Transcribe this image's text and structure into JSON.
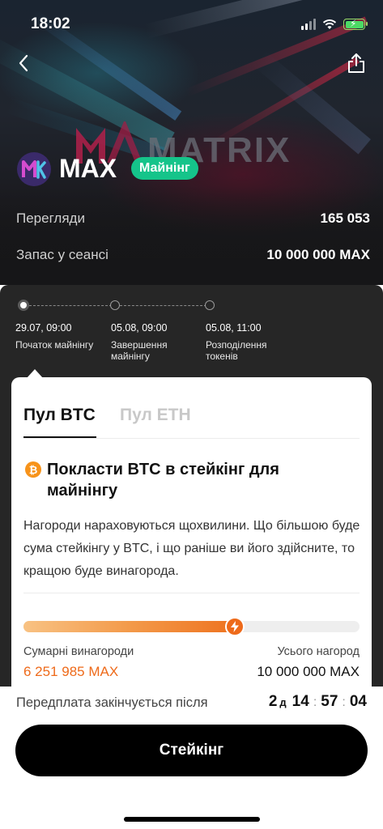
{
  "status_bar": {
    "time": "18:02"
  },
  "header": {
    "back_icon": "chevron-left-icon",
    "share_icon": "share-icon"
  },
  "hero": {
    "background_text": "MATRIX",
    "token_name": "MAX",
    "badge": "Майнінг",
    "views_label": "Перегляди",
    "views_value": "165 053",
    "supply_label": "Запас у сеансі",
    "supply_value": "10 000 000 MAX"
  },
  "timeline": [
    {
      "date": "29.07, 09:00",
      "label": "Початок майнінгу",
      "active": true
    },
    {
      "date": "05.08, 09:00",
      "label": "Завершення майнінгу",
      "active": false
    },
    {
      "date": "05.08, 11:00",
      "label": "Розподілення токенів",
      "active": false
    }
  ],
  "pool": {
    "tabs": [
      "Пул BTC",
      "Пул ETH"
    ],
    "active_tab": 0,
    "heading": "Покласти BTC в стейкінг для майнінгу",
    "description": "Нагороди нараховуються щохвилини. Що більшою буде сума стейкінгу у BTC, і що раніше ви його здійсните, то кращою буде винагорода.",
    "progress_fraction": 0.63,
    "total_rewards_label": "Сумарні винагороди",
    "total_rewards_value": "6 251 985 MAX",
    "all_rewards_label": "Усього нагород",
    "all_rewards_value": "10 000 000 MAX"
  },
  "footer": {
    "prepay_label": "Передплата закінчується після",
    "countdown": {
      "days": "2",
      "days_unit": "д",
      "hours": "14",
      "minutes": "57",
      "seconds": "04"
    },
    "stake_button": "Стейкінг"
  },
  "colors": {
    "accent_orange": "#ee6a1a",
    "badge_green": "#15c48a",
    "btc_orange": "#f7931a"
  }
}
